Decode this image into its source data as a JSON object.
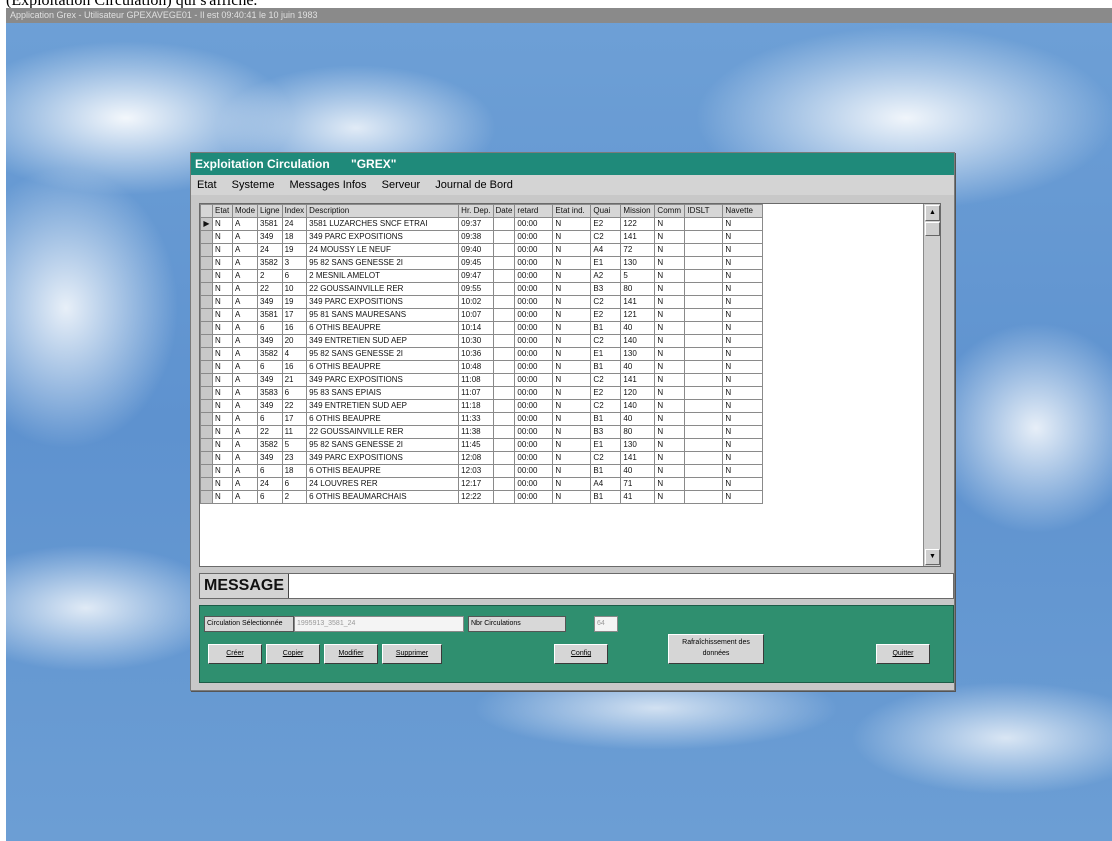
{
  "caption": "(Exploitation Circulation) qui s'affiche.",
  "os_titlebar": "Application Grex - Utilisateur GPEXAVEGE01 - Il est 09:40:41 le 10 juin 1983",
  "window": {
    "title": "Exploitation Circulation",
    "subtitle": "\"GREX\""
  },
  "menu": [
    "Etat",
    "Systeme",
    "Messages Infos",
    "Serveur",
    "Journal de Bord"
  ],
  "table": {
    "columns": [
      "Etat",
      "Mode",
      "Ligne",
      "Index",
      "Description",
      "Hr. Dep.",
      "Date",
      "retard",
      "Etat ind.",
      "Quai",
      "Mission",
      "Comm",
      "IDSLT",
      "Navette"
    ],
    "rows": [
      [
        "N",
        "A",
        "3581",
        "24",
        "3581 LUZARCHES SNCF ETRAI",
        "09:37",
        "",
        "00:00",
        "N",
        "E2",
        "122",
        "N",
        "",
        "N"
      ],
      [
        "N",
        "A",
        "349",
        "18",
        "349 PARC EXPOSITIONS",
        "09:38",
        "",
        "00:00",
        "N",
        "C2",
        "141",
        "N",
        "",
        "N"
      ],
      [
        "N",
        "A",
        "24",
        "19",
        "24 MOUSSY LE NEUF",
        "09:40",
        "",
        "00:00",
        "N",
        "A4",
        "72",
        "N",
        "",
        "N"
      ],
      [
        "N",
        "A",
        "3582",
        "3",
        "95 82 SANS GENESSE 2I",
        "09:45",
        "",
        "00:00",
        "N",
        "E1",
        "130",
        "N",
        "",
        "N"
      ],
      [
        "N",
        "A",
        "2",
        "6",
        "2 MESNIL AMELOT",
        "09:47",
        "",
        "00:00",
        "N",
        "A2",
        "5",
        "N",
        "",
        "N"
      ],
      [
        "N",
        "A",
        "22",
        "10",
        "22 GOUSSAINVILLE RER",
        "09:55",
        "",
        "00:00",
        "N",
        "B3",
        "80",
        "N",
        "",
        "N"
      ],
      [
        "N",
        "A",
        "349",
        "19",
        "349 PARC EXPOSITIONS",
        "10:02",
        "",
        "00:00",
        "N",
        "C2",
        "141",
        "N",
        "",
        "N"
      ],
      [
        "N",
        "A",
        "3581",
        "17",
        "95 81 SANS MAURESANS",
        "10:07",
        "",
        "00:00",
        "N",
        "E2",
        "121",
        "N",
        "",
        "N"
      ],
      [
        "N",
        "A",
        "6",
        "16",
        "6 OTHIS BEAUPRE",
        "10:14",
        "",
        "00:00",
        "N",
        "B1",
        "40",
        "N",
        "",
        "N"
      ],
      [
        "N",
        "A",
        "349",
        "20",
        "349 ENTRETIEN SUD AEP",
        "10:30",
        "",
        "00:00",
        "N",
        "C2",
        "140",
        "N",
        "",
        "N"
      ],
      [
        "N",
        "A",
        "3582",
        "4",
        "95 82 SANS GENESSE 2I",
        "10:36",
        "",
        "00:00",
        "N",
        "E1",
        "130",
        "N",
        "",
        "N"
      ],
      [
        "N",
        "A",
        "6",
        "16",
        "6 OTHIS BEAUPRE",
        "10:48",
        "",
        "00:00",
        "N",
        "B1",
        "40",
        "N",
        "",
        "N"
      ],
      [
        "N",
        "A",
        "349",
        "21",
        "349 PARC EXPOSITIONS",
        "11:08",
        "",
        "00:00",
        "N",
        "C2",
        "141",
        "N",
        "",
        "N"
      ],
      [
        "N",
        "A",
        "3583",
        "6",
        "95 83 SANS EPIAIS",
        "11:07",
        "",
        "00:00",
        "N",
        "E2",
        "120",
        "N",
        "",
        "N"
      ],
      [
        "N",
        "A",
        "349",
        "22",
        "349 ENTRETIEN SUD AEP",
        "11:18",
        "",
        "00:00",
        "N",
        "C2",
        "140",
        "N",
        "",
        "N"
      ],
      [
        "N",
        "A",
        "6",
        "17",
        "6 OTHIS BEAUPRE",
        "11:33",
        "",
        "00:00",
        "N",
        "B1",
        "40",
        "N",
        "",
        "N"
      ],
      [
        "N",
        "A",
        "22",
        "11",
        "22 GOUSSAINVILLE RER",
        "11:38",
        "",
        "00:00",
        "N",
        "B3",
        "80",
        "N",
        "",
        "N"
      ],
      [
        "N",
        "A",
        "3582",
        "5",
        "95 82 SANS GENESSE 2I",
        "11:45",
        "",
        "00:00",
        "N",
        "E1",
        "130",
        "N",
        "",
        "N"
      ],
      [
        "N",
        "A",
        "349",
        "23",
        "349 PARC EXPOSITIONS",
        "12:08",
        "",
        "00:00",
        "N",
        "C2",
        "141",
        "N",
        "",
        "N"
      ],
      [
        "N",
        "A",
        "6",
        "18",
        "6 OTHIS BEAUPRE",
        "12:03",
        "",
        "00:00",
        "N",
        "B1",
        "40",
        "N",
        "",
        "N"
      ],
      [
        "N",
        "A",
        "24",
        "6",
        "24 LOUVRES RER",
        "12:17",
        "",
        "00:00",
        "N",
        "A4",
        "71",
        "N",
        "",
        "N"
      ],
      [
        "N",
        "A",
        "6",
        "2",
        "6 OTHIS BEAUMARCHAIS",
        "12:22",
        "",
        "00:00",
        "N",
        "B1",
        "41",
        "N",
        "",
        "N"
      ]
    ]
  },
  "message_label": "MESSAGE",
  "message_value": "",
  "bottom": {
    "circ_label": "Circulation Sélectionnée",
    "circ_value": "1995913_3581_24",
    "nb_label": "Nbr Circulations",
    "nb_value": "64",
    "buttons": {
      "creer": "Créer",
      "copier": "Copier",
      "modifier": "Modifier",
      "supprimer": "Supprimer",
      "config": "Config",
      "refresh": "Rafraîchissement des données",
      "quitter": "Quitter"
    }
  }
}
